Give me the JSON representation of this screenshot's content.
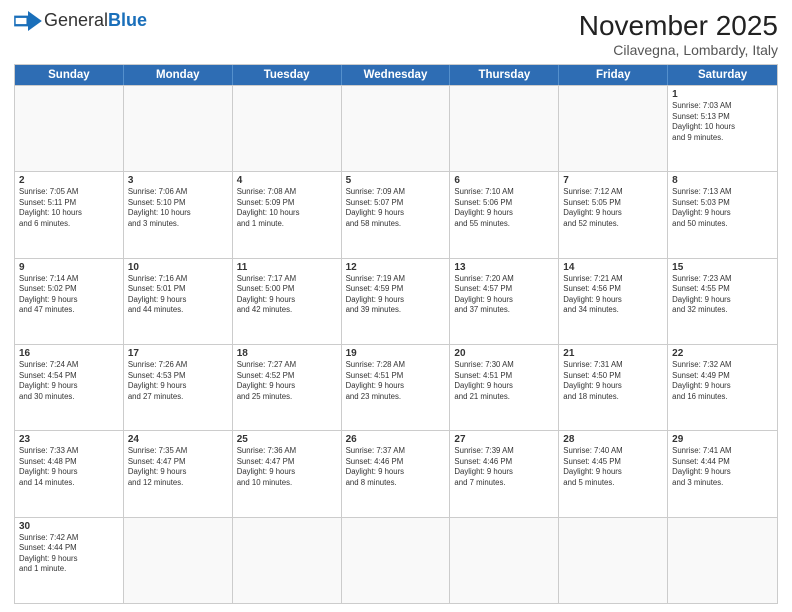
{
  "header": {
    "logo_general": "General",
    "logo_blue": "Blue",
    "month_title": "November 2025",
    "location": "Cilavegna, Lombardy, Italy"
  },
  "weekdays": [
    "Sunday",
    "Monday",
    "Tuesday",
    "Wednesday",
    "Thursday",
    "Friday",
    "Saturday"
  ],
  "rows": [
    [
      {
        "day": "",
        "info": ""
      },
      {
        "day": "",
        "info": ""
      },
      {
        "day": "",
        "info": ""
      },
      {
        "day": "",
        "info": ""
      },
      {
        "day": "",
        "info": ""
      },
      {
        "day": "",
        "info": ""
      },
      {
        "day": "1",
        "info": "Sunrise: 7:03 AM\nSunset: 5:13 PM\nDaylight: 10 hours\nand 9 minutes."
      }
    ],
    [
      {
        "day": "2",
        "info": "Sunrise: 7:05 AM\nSunset: 5:11 PM\nDaylight: 10 hours\nand 6 minutes."
      },
      {
        "day": "3",
        "info": "Sunrise: 7:06 AM\nSunset: 5:10 PM\nDaylight: 10 hours\nand 3 minutes."
      },
      {
        "day": "4",
        "info": "Sunrise: 7:08 AM\nSunset: 5:09 PM\nDaylight: 10 hours\nand 1 minute."
      },
      {
        "day": "5",
        "info": "Sunrise: 7:09 AM\nSunset: 5:07 PM\nDaylight: 9 hours\nand 58 minutes."
      },
      {
        "day": "6",
        "info": "Sunrise: 7:10 AM\nSunset: 5:06 PM\nDaylight: 9 hours\nand 55 minutes."
      },
      {
        "day": "7",
        "info": "Sunrise: 7:12 AM\nSunset: 5:05 PM\nDaylight: 9 hours\nand 52 minutes."
      },
      {
        "day": "8",
        "info": "Sunrise: 7:13 AM\nSunset: 5:03 PM\nDaylight: 9 hours\nand 50 minutes."
      }
    ],
    [
      {
        "day": "9",
        "info": "Sunrise: 7:14 AM\nSunset: 5:02 PM\nDaylight: 9 hours\nand 47 minutes."
      },
      {
        "day": "10",
        "info": "Sunrise: 7:16 AM\nSunset: 5:01 PM\nDaylight: 9 hours\nand 44 minutes."
      },
      {
        "day": "11",
        "info": "Sunrise: 7:17 AM\nSunset: 5:00 PM\nDaylight: 9 hours\nand 42 minutes."
      },
      {
        "day": "12",
        "info": "Sunrise: 7:19 AM\nSunset: 4:59 PM\nDaylight: 9 hours\nand 39 minutes."
      },
      {
        "day": "13",
        "info": "Sunrise: 7:20 AM\nSunset: 4:57 PM\nDaylight: 9 hours\nand 37 minutes."
      },
      {
        "day": "14",
        "info": "Sunrise: 7:21 AM\nSunset: 4:56 PM\nDaylight: 9 hours\nand 34 minutes."
      },
      {
        "day": "15",
        "info": "Sunrise: 7:23 AM\nSunset: 4:55 PM\nDaylight: 9 hours\nand 32 minutes."
      }
    ],
    [
      {
        "day": "16",
        "info": "Sunrise: 7:24 AM\nSunset: 4:54 PM\nDaylight: 9 hours\nand 30 minutes."
      },
      {
        "day": "17",
        "info": "Sunrise: 7:26 AM\nSunset: 4:53 PM\nDaylight: 9 hours\nand 27 minutes."
      },
      {
        "day": "18",
        "info": "Sunrise: 7:27 AM\nSunset: 4:52 PM\nDaylight: 9 hours\nand 25 minutes."
      },
      {
        "day": "19",
        "info": "Sunrise: 7:28 AM\nSunset: 4:51 PM\nDaylight: 9 hours\nand 23 minutes."
      },
      {
        "day": "20",
        "info": "Sunrise: 7:30 AM\nSunset: 4:51 PM\nDaylight: 9 hours\nand 21 minutes."
      },
      {
        "day": "21",
        "info": "Sunrise: 7:31 AM\nSunset: 4:50 PM\nDaylight: 9 hours\nand 18 minutes."
      },
      {
        "day": "22",
        "info": "Sunrise: 7:32 AM\nSunset: 4:49 PM\nDaylight: 9 hours\nand 16 minutes."
      }
    ],
    [
      {
        "day": "23",
        "info": "Sunrise: 7:33 AM\nSunset: 4:48 PM\nDaylight: 9 hours\nand 14 minutes."
      },
      {
        "day": "24",
        "info": "Sunrise: 7:35 AM\nSunset: 4:47 PM\nDaylight: 9 hours\nand 12 minutes."
      },
      {
        "day": "25",
        "info": "Sunrise: 7:36 AM\nSunset: 4:47 PM\nDaylight: 9 hours\nand 10 minutes."
      },
      {
        "day": "26",
        "info": "Sunrise: 7:37 AM\nSunset: 4:46 PM\nDaylight: 9 hours\nand 8 minutes."
      },
      {
        "day": "27",
        "info": "Sunrise: 7:39 AM\nSunset: 4:46 PM\nDaylight: 9 hours\nand 7 minutes."
      },
      {
        "day": "28",
        "info": "Sunrise: 7:40 AM\nSunset: 4:45 PM\nDaylight: 9 hours\nand 5 minutes."
      },
      {
        "day": "29",
        "info": "Sunrise: 7:41 AM\nSunset: 4:44 PM\nDaylight: 9 hours\nand 3 minutes."
      }
    ],
    [
      {
        "day": "30",
        "info": "Sunrise: 7:42 AM\nSunset: 4:44 PM\nDaylight: 9 hours\nand 1 minute."
      },
      {
        "day": "",
        "info": ""
      },
      {
        "day": "",
        "info": ""
      },
      {
        "day": "",
        "info": ""
      },
      {
        "day": "",
        "info": ""
      },
      {
        "day": "",
        "info": ""
      },
      {
        "day": "",
        "info": ""
      }
    ]
  ]
}
